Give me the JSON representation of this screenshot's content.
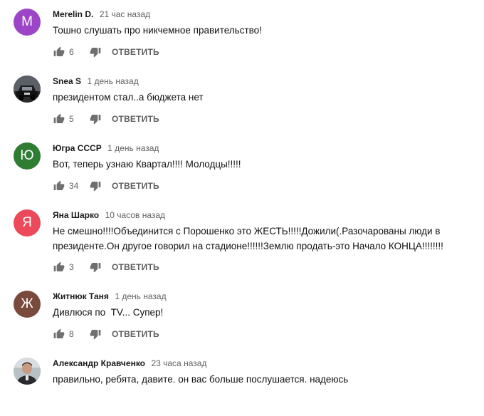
{
  "icons": {
    "like": "thumb-up-icon",
    "dislike": "thumb-down-icon"
  },
  "reply_label": "ОТВЕТИТЬ",
  "comments": [
    {
      "author": "Merelin D.",
      "time": "21 час назад",
      "text": "Тошно слушать про никчемное правительство!",
      "likes": "6",
      "avatar": {
        "type": "letter",
        "letter": "M",
        "color": "#9c45c7"
      }
    },
    {
      "author": "Snea S",
      "time": "1 день назад",
      "text": "президентом стал..а бюджета нет",
      "likes": "5",
      "avatar": {
        "type": "photo",
        "icon": "car-photo"
      }
    },
    {
      "author": "Югра СССР",
      "time": "1 день назад",
      "text": "Вот, теперь узнаю Квартал!!!! Молодцы!!!!!",
      "likes": "34",
      "avatar": {
        "type": "letter",
        "letter": "Ю",
        "color": "#2e7d32"
      }
    },
    {
      "author": "Яна Шарко",
      "time": "10 часов назад",
      "text_lines": [
        "Не смешно!!!!Объединится с Порошенко это ЖЕСТЬ!!!!!Дожили(.Разочарованы люди в",
        "президенте.Он другое говорил на стадионе!!!!!!Землю продать-это Начало КОНЦА!!!!!!!!"
      ],
      "likes": "3",
      "avatar": {
        "type": "letter",
        "letter": "Я",
        "color": "#ec4a5a"
      }
    },
    {
      "author": "Житнюк Таня",
      "time": "1 день назад",
      "text": "Дивлюся по  TV... Супер!",
      "likes": "8",
      "avatar": {
        "type": "letter",
        "letter": "Ж",
        "color": "#7a4a3d"
      }
    },
    {
      "author": "Александр Кравченко",
      "time": "23 часа назад",
      "text": "правильно, ребята, давите. он вас больше послушается. надеюсь",
      "avatar": {
        "type": "photo",
        "icon": "person-photo"
      }
    }
  ]
}
